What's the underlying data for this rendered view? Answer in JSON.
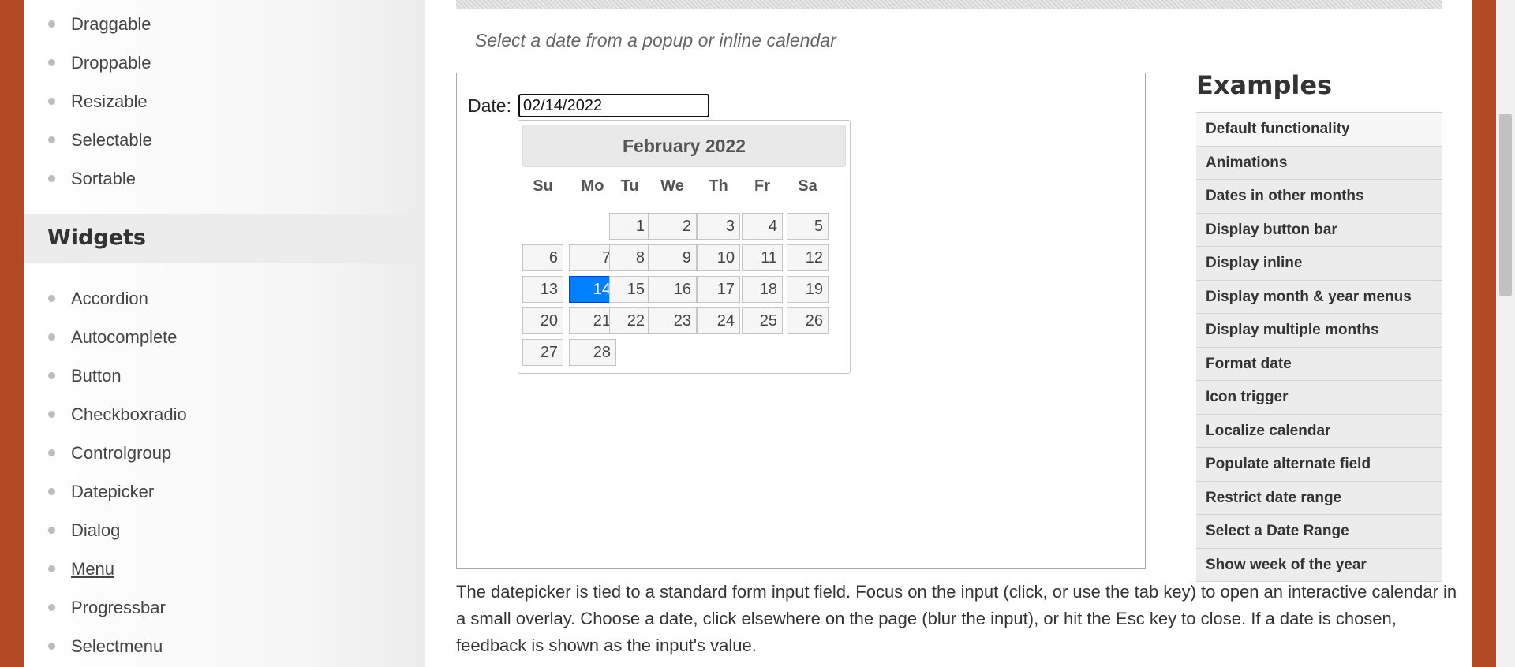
{
  "sidebar": {
    "interactions": [
      "Draggable",
      "Droppable",
      "Resizable",
      "Selectable",
      "Sortable"
    ],
    "widgets_header": "Widgets",
    "widgets": [
      "Accordion",
      "Autocomplete",
      "Button",
      "Checkboxradio",
      "Controlgroup",
      "Datepicker",
      "Dialog",
      "Menu",
      "Progressbar",
      "Selectmenu"
    ]
  },
  "main": {
    "subtitle": "Select a date from a popup or inline calendar",
    "date_label": "Date:",
    "date_value": "02/14/2022",
    "datepicker": {
      "title": "February 2022",
      "weekdays": [
        "Su",
        "Mo",
        "Tu",
        "We",
        "Th",
        "Fr",
        "Sa"
      ],
      "first_weekday_index": 2,
      "days_in_month": 28,
      "selected_day": 14
    },
    "description": "The datepicker is tied to a standard form input field. Focus on the input (click, or use the tab key) to open an interactive calendar in a small overlay. Choose a date, click elsewhere on the page (blur the input), or hit the Esc key to close. If a date is chosen, feedback is shown as the input's value."
  },
  "examples": {
    "title": "Examples",
    "items": [
      "Default functionality",
      "Animations",
      "Dates in other months",
      "Display button bar",
      "Display inline",
      "Display month & year menus",
      "Display multiple months",
      "Format date",
      "Icon trigger",
      "Localize calendar",
      "Populate alternate field",
      "Restrict date range",
      "Select a Date Range",
      "Show week of the year"
    ]
  },
  "colors": {
    "page_border": "#b24926",
    "selected_day": "#007fff"
  }
}
